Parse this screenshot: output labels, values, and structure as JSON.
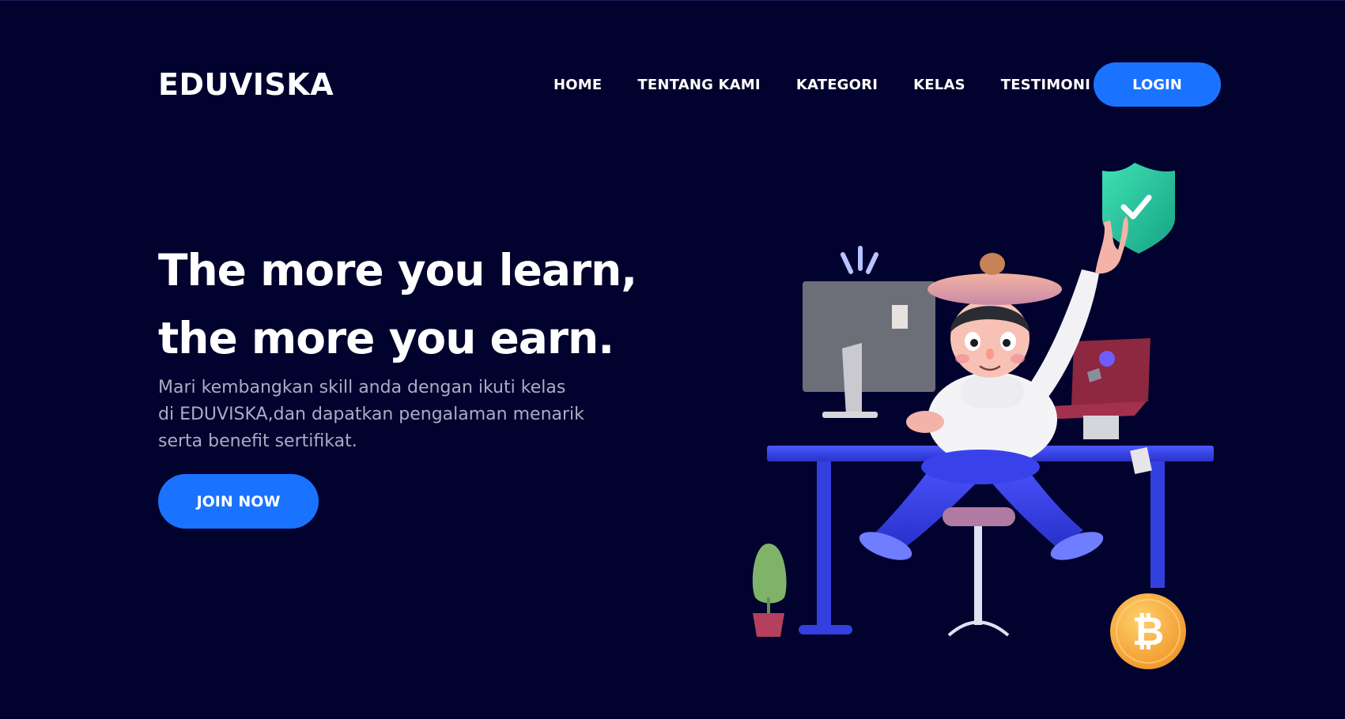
{
  "header": {
    "logo": "EDUVISKA",
    "nav": [
      {
        "label": "HOME"
      },
      {
        "label": "TENTANG KAMI"
      },
      {
        "label": "KATEGORI"
      },
      {
        "label": "KELAS"
      },
      {
        "label": "TESTIMONI"
      }
    ],
    "login_label": "LOGIN"
  },
  "hero": {
    "title_line1": "The more you learn,",
    "title_line2": "the more you earn.",
    "desc_line1": "Mari kembangkan skill anda dengan ikuti kelas",
    "desc_line2": "di EDUVISKA,dan dapatkan pengalaman menarik",
    "desc_line3": "serta benefit sertifikat.",
    "cta_label": "JOIN NOW"
  },
  "illustration": {
    "icons": [
      "shield-check-icon",
      "bitcoin-coin-icon",
      "plant-icon",
      "monitor-icon",
      "laptop-icon"
    ]
  },
  "colors": {
    "background": "#01022e",
    "accent": "#1a73ff",
    "text": "#ffffff",
    "muted_text": "#a9adc4"
  }
}
